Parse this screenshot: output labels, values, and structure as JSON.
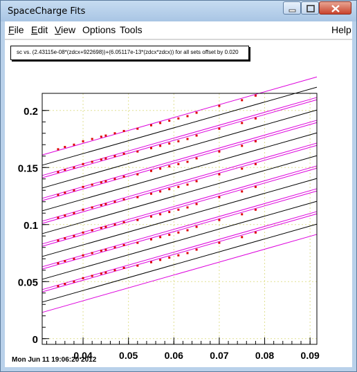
{
  "window": {
    "title": "SpaceCharge Fits"
  },
  "menubar": {
    "items": [
      {
        "label": "File",
        "mnemonic": "F",
        "rest": "ile"
      },
      {
        "label": "Edit",
        "mnemonic": "E",
        "rest": "dit"
      },
      {
        "label": "View",
        "mnemonic": "V",
        "rest": "iew"
      },
      {
        "label": "Options"
      },
      {
        "label": "Tools"
      }
    ],
    "help": "Help"
  },
  "plot": {
    "pave_text": "sc vs. (2.43115e-08*(zdcx+922698))+(6.05117e-13*(zdcx*zdcx)) for all sets offset by 0.020",
    "datestamp": "Mon Jun 11 19:06:20 2012"
  },
  "chart_data": {
    "type": "scatter",
    "title": "sc vs. (2.43115e-08*(zdcx+922698))+(6.05117e-13*(zdcx*zdcx)) for all sets offset by 0.020",
    "xlim": [
      0.031,
      0.0915
    ],
    "ylim": [
      -0.005,
      0.215
    ],
    "xticks": [
      "0.04",
      "0.05",
      "0.06",
      "0.07",
      "0.08",
      "0.09"
    ],
    "yticks": [
      "0",
      "0.05",
      "0.1",
      "0.15",
      "0.2"
    ],
    "grid": true,
    "offset": 0.02,
    "series_colors": {
      "points": "#dd0000",
      "fit": "#000000",
      "band": "#dd00dd"
    },
    "fit_lines": [
      {
        "x": [
          0.031,
          0.0915
        ],
        "y": [
          0.032,
          0.1004
        ]
      },
      {
        "x": [
          0.031,
          0.0915
        ],
        "y": [
          0.052,
          0.1204
        ]
      },
      {
        "x": [
          0.031,
          0.0915
        ],
        "y": [
          0.072,
          0.1404
        ]
      },
      {
        "x": [
          0.031,
          0.0915
        ],
        "y": [
          0.092,
          0.1604
        ]
      },
      {
        "x": [
          0.031,
          0.0915
        ],
        "y": [
          0.112,
          0.1804
        ]
      },
      {
        "x": [
          0.031,
          0.0915
        ],
        "y": [
          0.132,
          0.2004
        ]
      },
      {
        "x": [
          0.031,
          0.0915
        ],
        "y": [
          0.152,
          0.2204
        ]
      }
    ],
    "band_halfwidth": 0.009,
    "points": [
      [
        0.0345,
        0.046
      ],
      [
        0.036,
        0.048
      ],
      [
        0.038,
        0.05
      ],
      [
        0.04,
        0.053
      ],
      [
        0.042,
        0.055
      ],
      [
        0.044,
        0.057
      ],
      [
        0.045,
        0.058
      ],
      [
        0.047,
        0.06
      ],
      [
        0.049,
        0.062
      ],
      [
        0.052,
        0.064
      ],
      [
        0.055,
        0.067
      ],
      [
        0.057,
        0.069
      ],
      [
        0.059,
        0.071
      ],
      [
        0.061,
        0.073
      ],
      [
        0.063,
        0.075
      ],
      [
        0.065,
        0.078
      ],
      [
        0.07,
        0.084
      ],
      [
        0.075,
        0.089
      ],
      [
        0.078,
        0.093
      ],
      [
        0.0345,
        0.066
      ],
      [
        0.036,
        0.068
      ],
      [
        0.038,
        0.07
      ],
      [
        0.04,
        0.073
      ],
      [
        0.042,
        0.075
      ],
      [
        0.044,
        0.077
      ],
      [
        0.045,
        0.078
      ],
      [
        0.047,
        0.08
      ],
      [
        0.049,
        0.082
      ],
      [
        0.052,
        0.084
      ],
      [
        0.055,
        0.087
      ],
      [
        0.057,
        0.089
      ],
      [
        0.059,
        0.091
      ],
      [
        0.061,
        0.093
      ],
      [
        0.063,
        0.095
      ],
      [
        0.065,
        0.098
      ],
      [
        0.07,
        0.104
      ],
      [
        0.075,
        0.109
      ],
      [
        0.078,
        0.113
      ],
      [
        0.0345,
        0.086
      ],
      [
        0.036,
        0.088
      ],
      [
        0.038,
        0.09
      ],
      [
        0.04,
        0.093
      ],
      [
        0.042,
        0.095
      ],
      [
        0.044,
        0.097
      ],
      [
        0.045,
        0.098
      ],
      [
        0.047,
        0.1
      ],
      [
        0.049,
        0.102
      ],
      [
        0.052,
        0.104
      ],
      [
        0.055,
        0.107
      ],
      [
        0.057,
        0.109
      ],
      [
        0.059,
        0.111
      ],
      [
        0.061,
        0.113
      ],
      [
        0.063,
        0.115
      ],
      [
        0.065,
        0.118
      ],
      [
        0.07,
        0.124
      ],
      [
        0.075,
        0.129
      ],
      [
        0.078,
        0.133
      ],
      [
        0.0345,
        0.106
      ],
      [
        0.036,
        0.108
      ],
      [
        0.038,
        0.11
      ],
      [
        0.04,
        0.113
      ],
      [
        0.042,
        0.115
      ],
      [
        0.044,
        0.117
      ],
      [
        0.045,
        0.118
      ],
      [
        0.047,
        0.12
      ],
      [
        0.049,
        0.122
      ],
      [
        0.052,
        0.124
      ],
      [
        0.055,
        0.127
      ],
      [
        0.057,
        0.129
      ],
      [
        0.059,
        0.131
      ],
      [
        0.061,
        0.133
      ],
      [
        0.063,
        0.135
      ],
      [
        0.065,
        0.138
      ],
      [
        0.07,
        0.144
      ],
      [
        0.075,
        0.149
      ],
      [
        0.078,
        0.153
      ],
      [
        0.0345,
        0.126
      ],
      [
        0.036,
        0.128
      ],
      [
        0.038,
        0.13
      ],
      [
        0.04,
        0.133
      ],
      [
        0.042,
        0.135
      ],
      [
        0.044,
        0.137
      ],
      [
        0.045,
        0.138
      ],
      [
        0.047,
        0.14
      ],
      [
        0.049,
        0.142
      ],
      [
        0.052,
        0.144
      ],
      [
        0.055,
        0.147
      ],
      [
        0.057,
        0.149
      ],
      [
        0.059,
        0.151
      ],
      [
        0.061,
        0.153
      ],
      [
        0.063,
        0.155
      ],
      [
        0.065,
        0.158
      ],
      [
        0.07,
        0.164
      ],
      [
        0.075,
        0.169
      ],
      [
        0.078,
        0.173
      ],
      [
        0.0345,
        0.146
      ],
      [
        0.036,
        0.148
      ],
      [
        0.038,
        0.15
      ],
      [
        0.04,
        0.153
      ],
      [
        0.042,
        0.155
      ],
      [
        0.044,
        0.157
      ],
      [
        0.045,
        0.158
      ],
      [
        0.047,
        0.16
      ],
      [
        0.049,
        0.162
      ],
      [
        0.052,
        0.164
      ],
      [
        0.055,
        0.167
      ],
      [
        0.057,
        0.169
      ],
      [
        0.059,
        0.171
      ],
      [
        0.061,
        0.173
      ],
      [
        0.063,
        0.175
      ],
      [
        0.065,
        0.178
      ],
      [
        0.07,
        0.184
      ],
      [
        0.075,
        0.189
      ],
      [
        0.078,
        0.193
      ],
      [
        0.0345,
        0.166
      ],
      [
        0.036,
        0.168
      ],
      [
        0.038,
        0.17
      ],
      [
        0.04,
        0.173
      ],
      [
        0.042,
        0.175
      ],
      [
        0.044,
        0.177
      ],
      [
        0.045,
        0.178
      ],
      [
        0.047,
        0.18
      ],
      [
        0.049,
        0.182
      ],
      [
        0.052,
        0.184
      ],
      [
        0.055,
        0.187
      ],
      [
        0.057,
        0.189
      ],
      [
        0.059,
        0.191
      ],
      [
        0.061,
        0.193
      ],
      [
        0.063,
        0.195
      ],
      [
        0.065,
        0.198
      ],
      [
        0.07,
        0.204
      ],
      [
        0.075,
        0.209
      ],
      [
        0.078,
        0.213
      ]
    ]
  }
}
